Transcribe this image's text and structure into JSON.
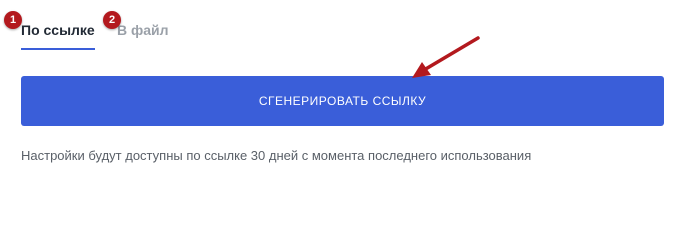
{
  "tabs": [
    {
      "label": "По ссылке",
      "active": true
    },
    {
      "label": "В файл",
      "active": false
    }
  ],
  "markers": [
    "1",
    "2"
  ],
  "generate_button": {
    "label": "СГЕНЕРИРОВАТЬ ССЫЛКУ"
  },
  "info_text": "Настройки будут доступны по ссылке 30 дней с момента последнего использования",
  "colors": {
    "accent": "#3a5ed9",
    "marker": "#b3191e",
    "arrow": "#b3191e",
    "active_tab_text": "#222a35",
    "inactive_tab_text": "#9aa0a8",
    "info_text": "#5a6068"
  }
}
